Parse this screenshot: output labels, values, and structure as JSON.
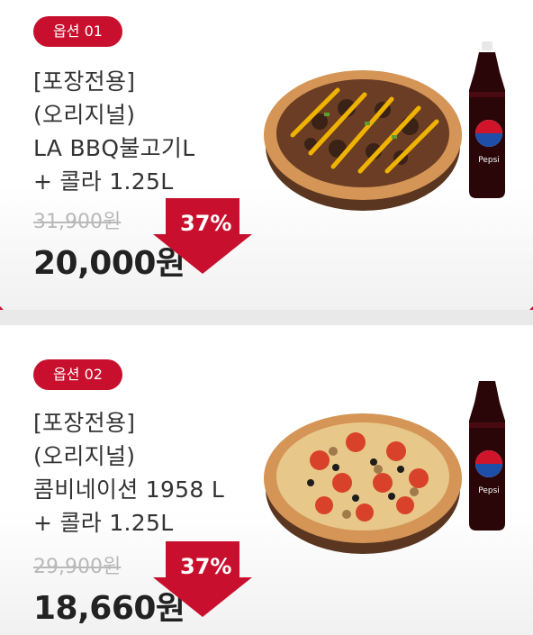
{
  "options": [
    {
      "badge": "옵션 01",
      "title_lines": [
        "[포장전용]",
        "(오리지널)",
        "LA BBQ불고기L",
        "+ 콜라 1.25L"
      ],
      "original_price": "31,900원",
      "sale_price": "20,000원",
      "discount": "37%"
    },
    {
      "badge": "옵션 02",
      "title_lines": [
        "[포장전용]",
        "(오리지널)",
        "콤비네이션 1958 L",
        "+ 콜라 1.25L"
      ],
      "original_price": "29,900원",
      "sale_price": "18,660원",
      "discount": "37%"
    }
  ],
  "cola_label": "Pepsi",
  "colors": {
    "brand_red": "#c8102e",
    "text": "#333333",
    "muted": "#b9b9b9"
  },
  "icons": [
    "down-arrow-discount-icon",
    "pizza-image",
    "cola-bottle-image"
  ]
}
